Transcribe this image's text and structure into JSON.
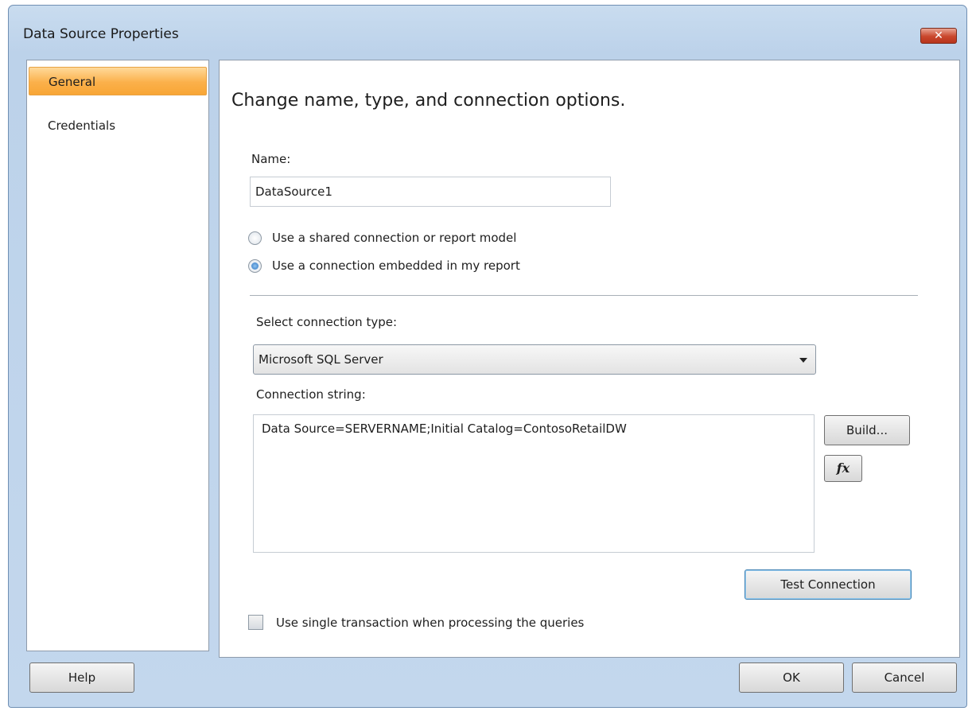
{
  "window": {
    "title": "Data Source Properties",
    "close_glyph": "✕"
  },
  "nav": {
    "items": [
      {
        "label": "General",
        "selected": true
      },
      {
        "label": "Credentials",
        "selected": false
      }
    ]
  },
  "general": {
    "heading": "Change name, type, and connection options.",
    "name_label": "Name:",
    "name_value": "DataSource1",
    "radio_shared_label": "Use a shared connection or report model",
    "radio_embedded_label": "Use a connection embedded in my report",
    "selected_radio": "embedded",
    "connection_type_label": "Select connection type:",
    "connection_type_value": "Microsoft SQL Server",
    "connection_string_label": "Connection string:",
    "connection_string_value": "Data Source=SERVERNAME;Initial Catalog=ContosoRetailDW",
    "build_label": "Build...",
    "expression_label": "fx",
    "test_connection_label": "Test Connection",
    "single_transaction_label": "Use single transaction when processing the queries",
    "single_transaction_checked": false
  },
  "footer": {
    "help_label": "Help",
    "ok_label": "OK",
    "cancel_label": "Cancel"
  },
  "colors": {
    "selected_nav": "#f8a636",
    "close_button": "#c9462c",
    "window_frame": "#bcd2ea"
  }
}
